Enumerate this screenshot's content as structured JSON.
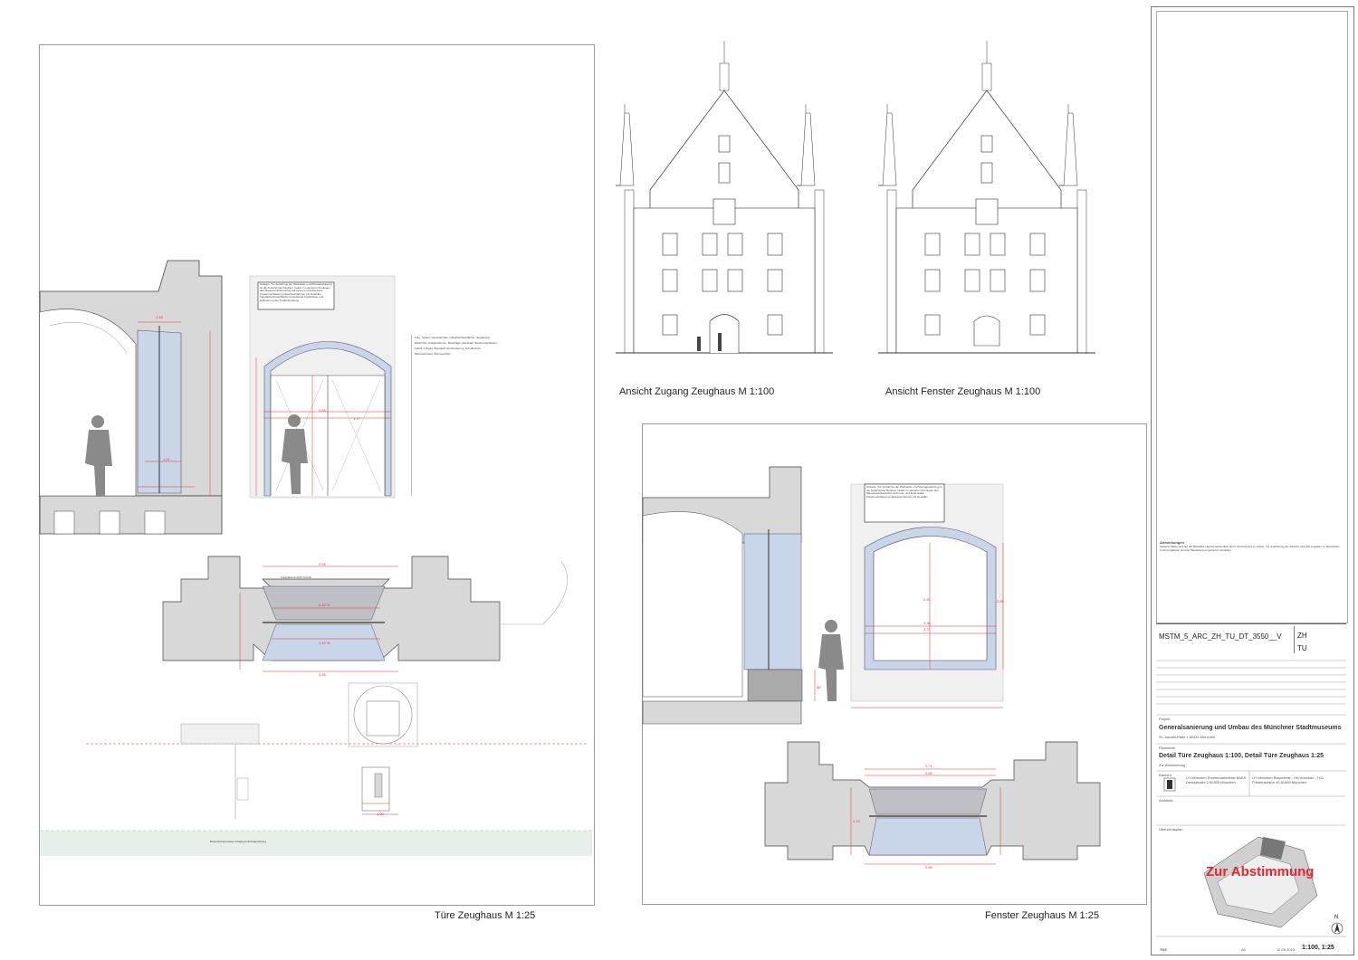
{
  "captions": {
    "elev_door": "Ansicht Zugang Zeughaus M 1:100",
    "elev_window": "Ansicht Fenster Zeughaus M 1:100",
    "detail_door": "Türe Zeughaus M 1:25",
    "detail_window": "Fenster Zeughaus M 1:25"
  },
  "dimensions": {
    "d_115": "1.15",
    "d_265": "2.65",
    "d_117": "1.17",
    "d_111": "1.11",
    "d_340": "3.40 %",
    "d_112p": "1.12 %",
    "d_200": "2.00",
    "d_100": "1.00",
    "d_271": "2.71",
    "d_285": "2.85",
    "d_236": "2.36",
    "d_371": "3.71",
    "d_114": "1.14",
    "d_281": "2.81",
    "d_295": "2.95",
    "d_85": "85"
  },
  "plan_labels": {
    "hinweis_door": "Hinweis: Vor Aufnahme der Werkstatt- und Montageplanung ist die bestehende Situation mittels zu sanierten (Freilegen des Mauerwerksbereichs) auf Innen und Außenseite. Zusammenfassung Natursteinrahmen mit Gewölbe, Fangfarbe/Ansatzfläche bestehende Anschlüsse und Erläuterung der Tragbefestigung",
    "hinweis_window": "Hinweis: Vor Aufnahme der Werkstatt- und Montageplanung ist die bestehende Situation mittels zu sanierten (Freilegen des Mauerwerksbereichs) auf Innen und Außenseite. Zusammenfassung Natursteinrahmen mit Gewölbe",
    "spec_block": "Türe: System Fassadenbau, Glasabschlussfläche, Verglasung ESG/VSG, Aufsatzrahmen, Beschläge, Edelstahl, Bodentürschließer, Falttür 2-flüglig, Brandschutzanforderung, Schallschutz, Barrierefreiheit, Wärmeschutz",
    "kopf_note": "Kopfplatte Ansicht Antrieb",
    "bodentrans": "Bodentransportweg 2-flüglig Aufschlagrichtung"
  },
  "titleblock": {
    "anmerkungen_head": "Anmerkungen",
    "anmerkungen_text": "Sanierte Maße sind auf der Baustelle eigenverantwortlich durch Vermessung zu prüfen. Vor Ausführung der Arbeiten sind alle Angaben zu überprüfen. Unstimmigkeiten sind der Bauleitung umgehend mitzuteilen.",
    "plan_code": "MSTM_5_ARC_ZH_TU_DT_3550__V",
    "code_zh": "ZH",
    "code_tu": "TU",
    "projekt_label": "Projekt",
    "projekt": "Generalsanierung und Umbau des Münchner Stadtmuseums",
    "projekt_sub": "St.-Jakobs-Platz 1 80331 München",
    "planinhalt_label": "Planinhalt",
    "planinhalt": "Detail Türe Zeughaus 1:100, Detail Türe Zeughaus 1:25",
    "planinhalt_sub": "Zur Abstimmung",
    "bauherr_label": "Bauherr",
    "bauherr": "LH München Kommunalreferat BAKS Denisstraße 2 80335 München",
    "bauherr2": "LH München Baureferat - HA Hochbau - H11 Friedenstraße 40 81660 München",
    "architekt_label": "Architekt",
    "ubersicht_label": "Übersichtsplan",
    "stamp": "Zur Abstimmung",
    "north": "N",
    "scale": "1:100, 1:25",
    "date": "12.05.2023",
    "index": "TK5",
    "format": "A0",
    "bottom_labels": [
      "Format",
      "Blatt",
      "Datum",
      "Maßstab"
    ]
  },
  "colors": {
    "wall_fill": "#d8d8d8",
    "glass_fill": "#c9d6ea",
    "dim_red": "#e1342f",
    "line": "#333333",
    "stamp_red": "#e3262b"
  }
}
